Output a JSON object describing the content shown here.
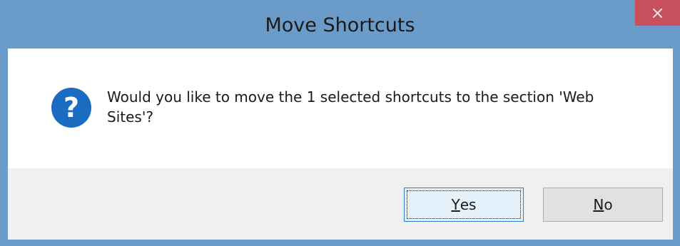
{
  "window": {
    "title": "Move Shortcuts",
    "close_glyph": "×"
  },
  "message": {
    "icon": "question-icon",
    "icon_glyph": "?",
    "text": "Would you like to move the 1 selected shortcuts to the section 'Web Sites'?"
  },
  "buttons": {
    "yes": {
      "mnemonic": "Y",
      "rest": "es"
    },
    "no": {
      "mnemonic": "N",
      "rest": "o"
    }
  },
  "colors": {
    "titlebar": "#6b9bc9",
    "close": "#c7505c",
    "icon": "#1a6cc0",
    "focus_border": "#2e7fd1"
  }
}
